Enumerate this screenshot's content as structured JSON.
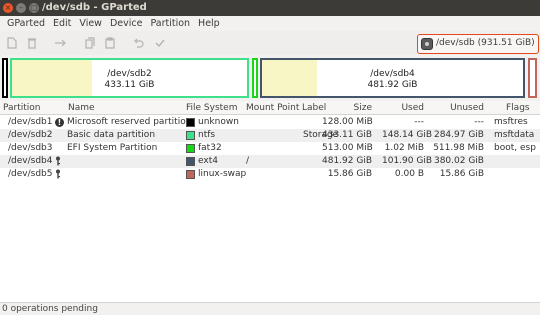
{
  "window": {
    "title": "/dev/sdb - GParted",
    "close_glyph": "×",
    "min_glyph": "–",
    "max_glyph": "□"
  },
  "menu": [
    "GParted",
    "Edit",
    "View",
    "Device",
    "Partition",
    "Help"
  ],
  "toolbar": {
    "icons": [
      "new-icon",
      "delete-icon",
      "resize-move-icon",
      "copy-icon",
      "paste-icon",
      "undo-icon",
      "apply-icon"
    ],
    "device_selector": "/dev/sdb   (931.51 GiB)"
  },
  "partition_map": [
    {
      "name": "/dev/sdb2",
      "size": "433.11 GiB",
      "used_fraction": 0.34,
      "border": "#3fe08c"
    },
    {
      "name": "/dev/sdb4",
      "size": "481.92 GiB",
      "used_fraction": 0.21,
      "border": "#42556a"
    }
  ],
  "colors": {
    "ntfs": "#3fe08c",
    "unknown": "#000000",
    "fat32": "#18d814",
    "ext4": "#42556a",
    "linux-swap": "#c1665a",
    "selected_border": "#e04a1c"
  },
  "table": {
    "headers": [
      "Partition",
      "Name",
      "File System",
      "Mount Point",
      "Label",
      "Size",
      "Used",
      "Unused",
      "Flags"
    ],
    "rows": [
      {
        "partition": "/dev/sdb1",
        "icon": "!",
        "name": "Microsoft reserved partition",
        "fs": "unknown",
        "fs_color": "#000000",
        "mount": "",
        "label": "",
        "size": "128.00 MiB",
        "used": "---",
        "unused": "---",
        "flags": "msftres"
      },
      {
        "partition": "/dev/sdb2",
        "icon": "",
        "name": "Basic data partition",
        "fs": "ntfs",
        "fs_color": "#3fe08c",
        "mount": "",
        "label": "Storage",
        "size": "433.11 GiB",
        "used": "148.14 GiB",
        "unused": "284.97 GiB",
        "flags": "msftdata"
      },
      {
        "partition": "/dev/sdb3",
        "icon": "",
        "name": "EFI System Partition",
        "fs": "fat32",
        "fs_color": "#18d814",
        "mount": "",
        "label": "",
        "size": "513.00 MiB",
        "used": "1.02 MiB",
        "unused": "511.98 MiB",
        "flags": "boot, esp"
      },
      {
        "partition": "/dev/sdb4",
        "icon": "🔑",
        "name": "",
        "fs": "ext4",
        "fs_color": "#42556a",
        "mount": "/",
        "label": "",
        "size": "481.92 GiB",
        "used": "101.90 GiB",
        "unused": "380.02 GiB",
        "flags": ""
      },
      {
        "partition": "/dev/sdb5",
        "icon": "🔑",
        "name": "",
        "fs": "linux-swap",
        "fs_color": "#c1665a",
        "mount": "",
        "label": "",
        "size": "15.86 GiB",
        "used": "0.00 B",
        "unused": "15.86 GiB",
        "flags": ""
      }
    ]
  },
  "status": "0 operations pending"
}
